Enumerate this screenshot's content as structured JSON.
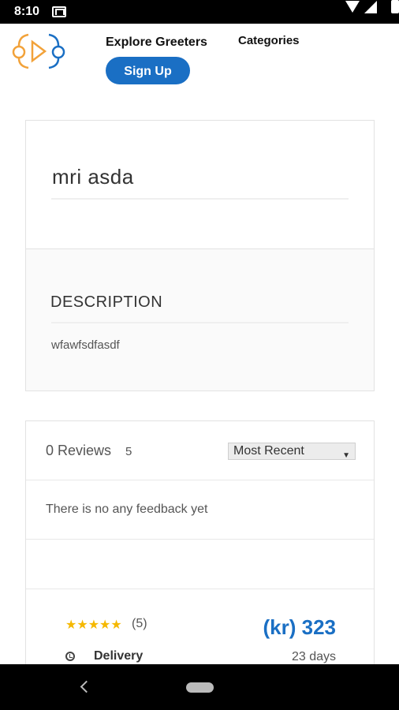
{
  "status_bar": {
    "time": "8:10",
    "icons": [
      "gmail-icon",
      "wifi-icon",
      "signal-icon",
      "battery-icon"
    ]
  },
  "header": {
    "nav_explore": "Explore Greeters",
    "nav_categories": "Categories",
    "signup_label": "Sign Up"
  },
  "listing": {
    "title": "mri asda"
  },
  "description": {
    "heading": "DESCRIPTION",
    "text": "wfawfsdfasdf"
  },
  "reviews": {
    "count_label": "0 Reviews",
    "score": "5",
    "sort_selected": "Most Recent",
    "empty_text": "There is no any feedback yet"
  },
  "booking": {
    "rating_count": "(5)",
    "stars": 5,
    "price": "(kr) 323",
    "delivery_label": "Delivery",
    "delivery_value": "23 days"
  },
  "colors": {
    "accent": "#1a6fc4",
    "star": "#f5b800"
  }
}
